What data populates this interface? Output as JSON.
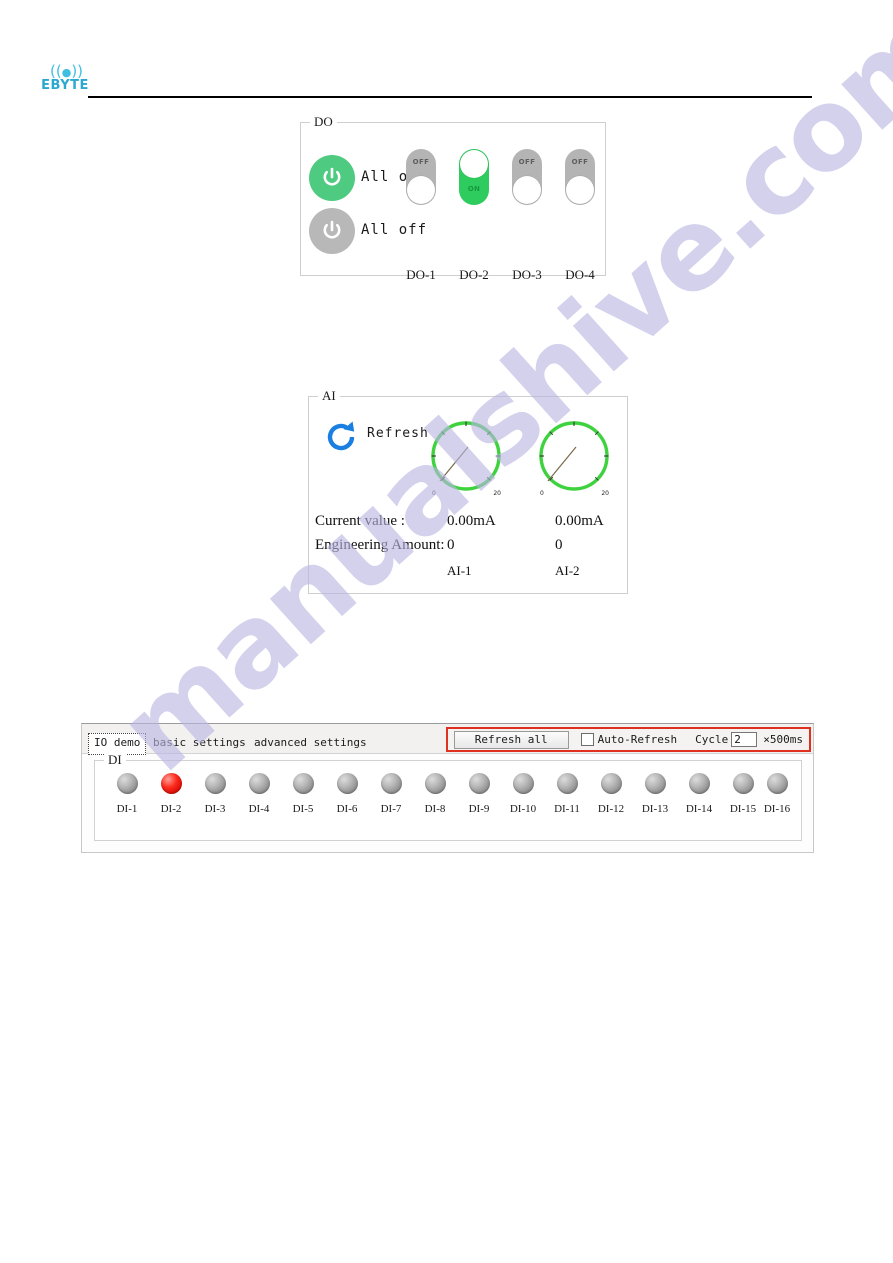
{
  "header": {
    "brand": "EBYTE",
    "wifi_icon": "antenna-signal-icon"
  },
  "watermark": {
    "text": "manualshive.com"
  },
  "do_panel": {
    "legend": "DO",
    "all_on_label": "All on",
    "all_off_label": "All off",
    "power_icon": "power-icon",
    "on_color": "#4ecb80",
    "off_color": "#b8b8b8",
    "toggle_on_color": "#2ecc5e",
    "toggle_off_color": "#b4b4b4",
    "channels": [
      {
        "name": "DO-1",
        "state": "OFF"
      },
      {
        "name": "DO-2",
        "state": "ON"
      },
      {
        "name": "DO-3",
        "state": "OFF"
      },
      {
        "name": "DO-4",
        "state": "OFF"
      }
    ]
  },
  "ai_panel": {
    "legend": "AI",
    "refresh_label": "Refresh",
    "refresh_icon": "refresh-circular-arrow-icon",
    "refresh_color": "#1a7fe0",
    "gauge_color": "#3fd23f",
    "row_labels": {
      "current_value": "Current value :",
      "engineering_amount": "Engineering Amount:"
    },
    "channels": [
      {
        "name": "AI-1",
        "current_value": "0.00mA",
        "engineering_amount": "0",
        "gauge_min": "0",
        "gauge_max": "20",
        "gauge_value": 0
      },
      {
        "name": "AI-2",
        "current_value": "0.00mA",
        "engineering_amount": "0",
        "gauge_min": "0",
        "gauge_max": "20",
        "gauge_value": 0
      }
    ]
  },
  "app_window": {
    "tabs": [
      {
        "label": "IO demo",
        "selected": true
      },
      {
        "label": "basic settings",
        "selected": false
      },
      {
        "label": "advanced settings",
        "selected": false
      }
    ],
    "toolbar": {
      "refresh_all_label": "Refresh all",
      "auto_refresh_label": "Auto-Refresh",
      "auto_refresh_checked": false,
      "cycle_label": "Cycle",
      "cycle_value": "2",
      "cycle_unit": "×500ms",
      "highlight_color": "#e03020"
    },
    "di_panel": {
      "legend": "DI",
      "led_on_color": "#fb2a1c",
      "led_off_color": "#b6b6b6",
      "channels": [
        {
          "name": "DI-1",
          "state": "off"
        },
        {
          "name": "DI-2",
          "state": "on"
        },
        {
          "name": "DI-3",
          "state": "off"
        },
        {
          "name": "DI-4",
          "state": "off"
        },
        {
          "name": "DI-5",
          "state": "off"
        },
        {
          "name": "DI-6",
          "state": "off"
        },
        {
          "name": "DI-7",
          "state": "off"
        },
        {
          "name": "DI-8",
          "state": "off"
        },
        {
          "name": "DI-9",
          "state": "off"
        },
        {
          "name": "DI-10",
          "state": "off"
        },
        {
          "name": "DI-11",
          "state": "off"
        },
        {
          "name": "DI-12",
          "state": "off"
        },
        {
          "name": "DI-13",
          "state": "off"
        },
        {
          "name": "DI-14",
          "state": "off"
        },
        {
          "name": "DI-15",
          "state": "off"
        },
        {
          "name": "DI-16",
          "state": "off"
        }
      ]
    }
  }
}
